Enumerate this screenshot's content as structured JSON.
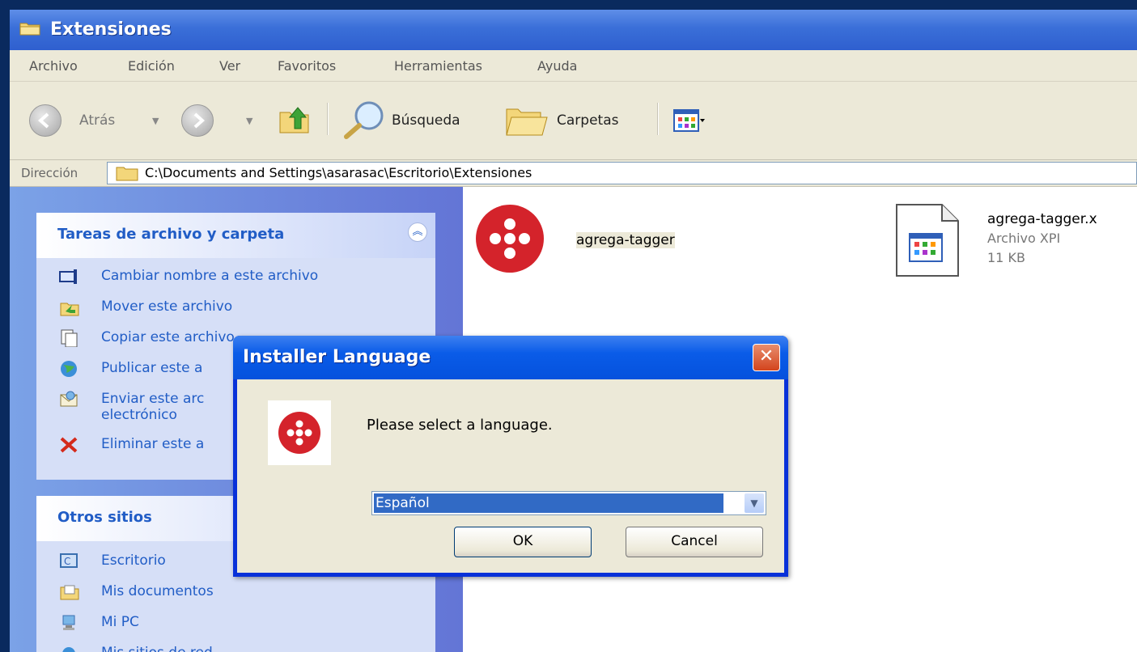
{
  "window": {
    "title": "Extensiones"
  },
  "menu": [
    "Archivo",
    "Edición",
    "Ver",
    "Favoritos",
    "Herramientas",
    "Ayuda"
  ],
  "toolbar": {
    "back_label": "Atrás",
    "search_label": "Búsqueda",
    "folders_label": "Carpetas"
  },
  "address": {
    "label": "Dirección",
    "path": "C:\\Documents and Settings\\asarasac\\Escritorio\\Extensiones"
  },
  "sidebar": {
    "file_tasks": {
      "title": "Tareas de archivo y carpeta",
      "items": [
        "Cambiar nombre a este archivo",
        "Mover este archivo",
        "Copiar este archivo",
        "Publicar este a",
        "Enviar este arc",
        "electrónico",
        "Eliminar este a"
      ]
    },
    "other_places": {
      "title": "Otros sitios",
      "items": [
        "Escritorio",
        "Mis documentos",
        "Mi PC",
        "Mis sitios de red"
      ]
    }
  },
  "files": [
    {
      "name": "agrega-tagger"
    },
    {
      "name": "agrega-tagger.x",
      "type": "Archivo XPI",
      "size": "11 KB"
    }
  ],
  "dialog": {
    "title": "Installer Language",
    "message": "Please select a language.",
    "selected_language": "Español",
    "ok_label": "OK",
    "cancel_label": "Cancel"
  },
  "colors": {
    "title_blue": "#3a6fd8",
    "dialog_blue": "#0551dd",
    "link_blue": "#215dc6",
    "logo_red": "#d4232b"
  }
}
